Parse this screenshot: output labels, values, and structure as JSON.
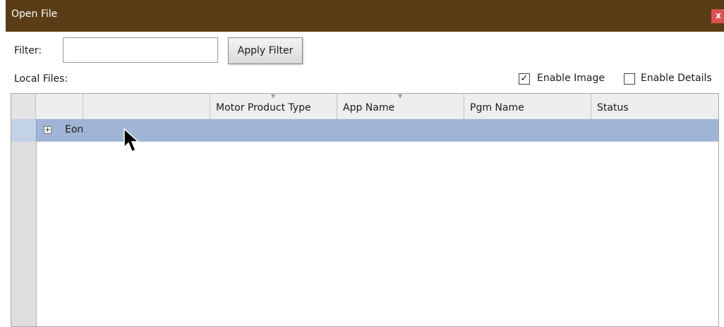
{
  "window": {
    "title": "Open File",
    "close_label": "x"
  },
  "filter": {
    "label": "Filter:",
    "value": "",
    "button_label": "Apply Filter"
  },
  "local_files": {
    "label": "Local Files:"
  },
  "options": {
    "enable_image": {
      "label": "Enable Image",
      "checked": true,
      "mark": "✓"
    },
    "enable_details": {
      "label": "Enable Details",
      "checked": false
    }
  },
  "grid": {
    "columns": [
      "",
      "",
      "Motor Product Type",
      "App Name",
      "Pgm Name",
      "Status"
    ],
    "rows": [
      {
        "expander": "+",
        "label": "Eon",
        "selected": true
      }
    ]
  },
  "colors": {
    "titlebar": "#5a3d16",
    "close_button": "#d9534f",
    "selected_row": "#a0b5d5"
  },
  "icons": {
    "close": "close-icon",
    "expand": "expand-plus-icon",
    "sort": "sort-arrow-icon",
    "cursor": "mouse-pointer-icon"
  }
}
